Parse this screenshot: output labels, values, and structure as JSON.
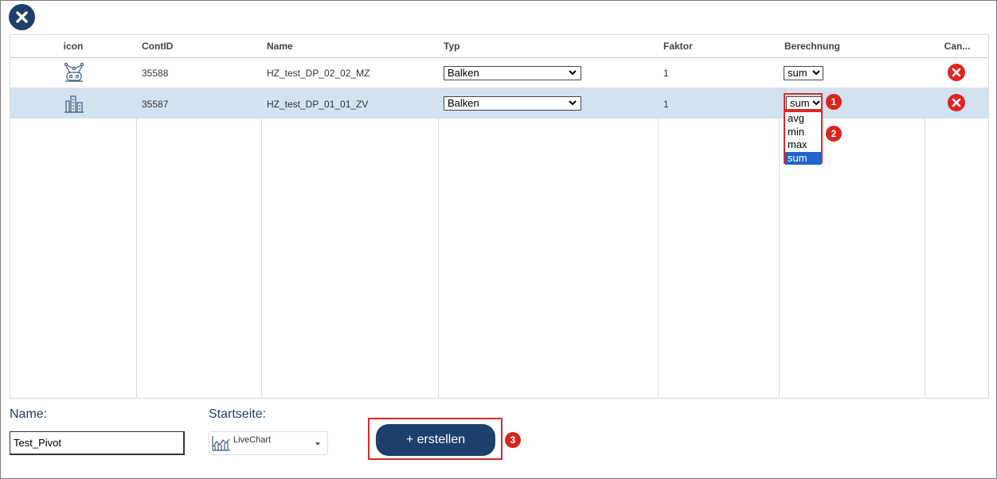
{
  "dialog": {
    "close_icon": "close-circle-icon"
  },
  "table": {
    "headers": [
      "icon",
      "ContID",
      "Name",
      "Typ",
      "Faktor",
      "Berechnung",
      "Can..."
    ],
    "rows": [
      {
        "icon": "network-robot-icon",
        "cont_id": "35588",
        "name": "HZ_test_DP_02_02_MZ",
        "typ": "Balken",
        "faktor": "1",
        "berechnung": "sum",
        "delete_icon": "delete-circle-icon"
      },
      {
        "icon": "building-chart-icon",
        "cont_id": "35587",
        "name": "HZ_test_DP_01_01_ZV",
        "typ": "Balken",
        "faktor": "1",
        "berechnung": "sum",
        "delete_icon": "delete-circle-icon"
      }
    ],
    "berechnung_options": [
      "avg",
      "min",
      "max",
      "sum"
    ],
    "berechnung_selected": "sum"
  },
  "annotations": {
    "badge1": "1",
    "badge2": "2",
    "badge3": "3",
    "highlight_color": "#d92b2b"
  },
  "form": {
    "name_label": "Name:",
    "name_value": "Test_Pivot",
    "start_label": "Startseite:",
    "start_value": "LiveChart",
    "start_icon": "line-chart-icon",
    "create_label": "+ erstellen"
  },
  "colors": {
    "primary": "#1d3f6b",
    "selected_row": "#d3e2ef",
    "delete": "#e02424",
    "option_selected": "#1f64c8"
  }
}
